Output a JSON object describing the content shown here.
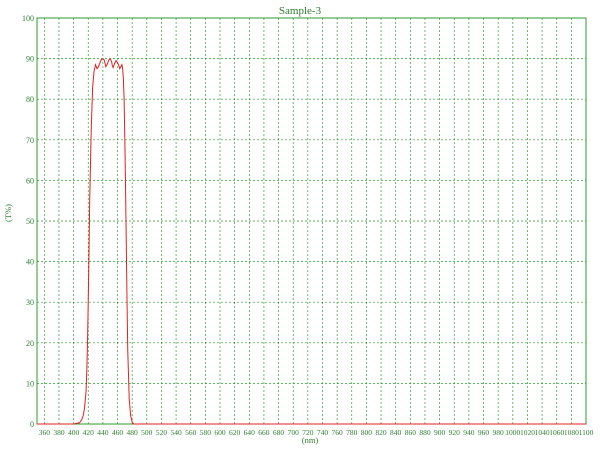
{
  "chart_data": {
    "type": "line",
    "title": "Sample-3",
    "xlabel": "(nm)",
    "ylabel": "(T%)",
    "xlim": [
      350,
      1100
    ],
    "ylim": [
      0,
      100
    ],
    "grid": true,
    "x_ticks": [
      360,
      380,
      400,
      420,
      440,
      460,
      480,
      500,
      520,
      540,
      560,
      580,
      600,
      620,
      640,
      660,
      680,
      700,
      720,
      740,
      760,
      780,
      800,
      820,
      840,
      860,
      880,
      900,
      920,
      940,
      960,
      980,
      1000,
      1020,
      1040,
      1060,
      1080,
      1100
    ],
    "y_ticks": [
      0,
      10,
      20,
      30,
      40,
      50,
      60,
      70,
      80,
      90,
      100
    ],
    "colors": {
      "axis": "#2e7d32",
      "grid": "#2e9a2e",
      "curve": "#e02020"
    },
    "series": [
      {
        "x": [
          350,
          400,
          408,
          411,
          413,
          415,
          417,
          418,
          419,
          420,
          421,
          422,
          424,
          426,
          428,
          430,
          431,
          432,
          434,
          436,
          438,
          440,
          442,
          443,
          444,
          446,
          448,
          450,
          452,
          453,
          454,
          456,
          458,
          460,
          462,
          463,
          464,
          466,
          467,
          468,
          469,
          470,
          471,
          472,
          473,
          474,
          476,
          478,
          480,
          481,
          482,
          490,
          1100
        ],
        "y": [
          0,
          0,
          0.3,
          1,
          2,
          4,
          8,
          13,
          20,
          30,
          42,
          55,
          72,
          83,
          87,
          88.5,
          88,
          87.5,
          88,
          89,
          89.8,
          90,
          89.6,
          88.8,
          88,
          88.6,
          89.6,
          90,
          89.2,
          88.2,
          87.8,
          88.8,
          89.5,
          89,
          88.2,
          87.5,
          87.8,
          88.5,
          87.5,
          85,
          80,
          70,
          58,
          44,
          30,
          18,
          6,
          2,
          0.5,
          0.2,
          0,
          0,
          0
        ]
      }
    ]
  }
}
